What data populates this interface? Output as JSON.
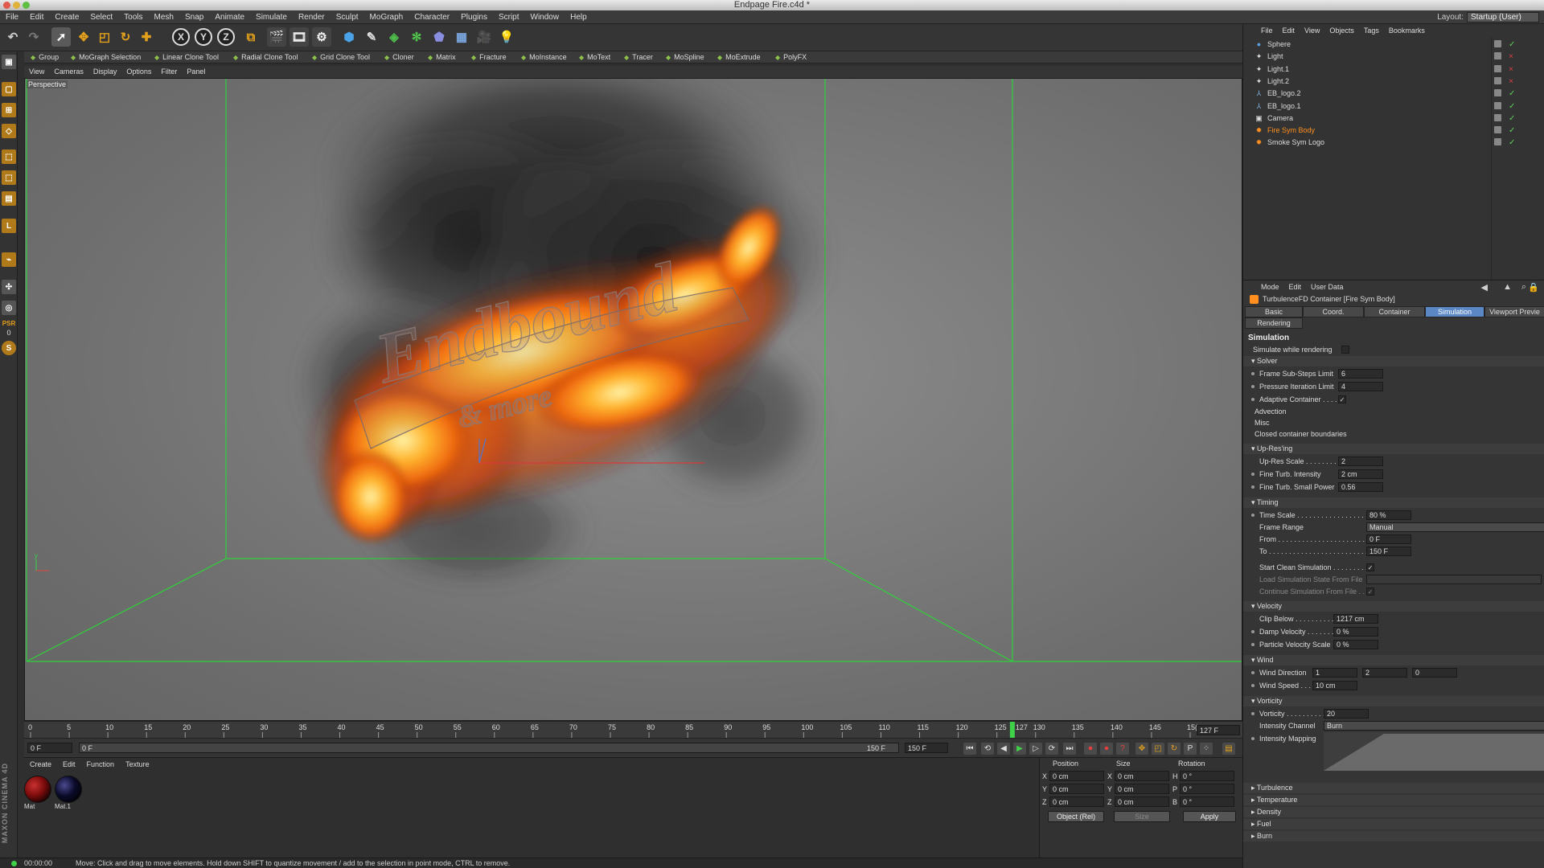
{
  "app": {
    "title": "Endpage Fire.c4d *",
    "menus": [
      "File",
      "Edit",
      "Create",
      "Select",
      "Tools",
      "Mesh",
      "Snap",
      "Animate",
      "Simulate",
      "Render",
      "Sculpt",
      "MoGraph",
      "Character",
      "Plugins",
      "Script",
      "Window",
      "Help"
    ],
    "layout_label": "Layout:",
    "layout_value": "Startup (User)"
  },
  "toolbar": {
    "axis_x": "X",
    "axis_y": "Y",
    "axis_z": "Z"
  },
  "mograph_bar": [
    "Group",
    "MoGraph Selection",
    "Linear Clone Tool",
    "Radial Clone Tool",
    "Grid Clone Tool",
    "Cloner",
    "Matrix",
    "Fracture",
    "MoInstance",
    "MoText",
    "Tracer",
    "MoSpline",
    "MoExtrude",
    "PolyFX"
  ],
  "left_palette": {
    "psr": "PSR",
    "psr_value": "0",
    "maxon": "MAXON CINEMA 4D"
  },
  "viewport": {
    "menus": [
      "View",
      "Cameras",
      "Display",
      "Options",
      "Filter",
      "Panel"
    ],
    "label": "Perspective",
    "axis_y": "y",
    "logo_text_1": "Endbound",
    "logo_text_2": "& more"
  },
  "timeline": {
    "ticks": [
      0,
      5,
      10,
      15,
      20,
      25,
      30,
      35,
      40,
      45,
      50,
      55,
      60,
      65,
      70,
      75,
      80,
      85,
      90,
      95,
      100,
      105,
      110,
      115,
      120,
      125,
      130,
      135,
      140,
      145,
      150
    ],
    "current_frame": 127,
    "max_frame": 150,
    "current_label": "127",
    "end_label": "15(",
    "current_field": "127 F"
  },
  "playbar": {
    "start_field": "0 F",
    "range_start": "0 F",
    "range_end": "150 F",
    "end_field": "150 F"
  },
  "material_manager": {
    "menus": [
      "Create",
      "Edit",
      "Function",
      "Texture"
    ],
    "materials": [
      {
        "name": "Mat",
        "color": "#7a0b0b"
      },
      {
        "name": "Mat.1",
        "color": "#0b0b2a"
      }
    ]
  },
  "coordinates": {
    "headers": [
      "Position",
      "Size",
      "Rotation"
    ],
    "rows": [
      {
        "axis": "X",
        "position": "0 cm",
        "size_axis": "X",
        "size": "0 cm",
        "rot_axis": "H",
        "rotation": "0 °"
      },
      {
        "axis": "Y",
        "position": "0 cm",
        "size_axis": "Y",
        "size": "0 cm",
        "rot_axis": "P",
        "rotation": "0 °"
      },
      {
        "axis": "Z",
        "position": "0 cm",
        "size_axis": "Z",
        "size": "0 cm",
        "rot_axis": "B",
        "rotation": "0 °"
      }
    ],
    "mode": "Object (Rel)",
    "size_mode": "Size",
    "apply": "Apply"
  },
  "status": {
    "time": "00:00:00",
    "message": "Move: Click and drag to move elements. Hold down SHIFT to quantize movement / add to the selection in point mode, CTRL to remove."
  },
  "object_manager": {
    "menus": [
      "File",
      "Edit",
      "View",
      "Objects",
      "Tags",
      "Bookmarks"
    ],
    "objects": [
      {
        "name": "Sphere",
        "icon": "sphere-icon",
        "color": "#5aa0e0",
        "x": ""
      },
      {
        "name": "Light",
        "icon": "light-icon",
        "color": "#dddddd",
        "x": "×"
      },
      {
        "name": "Light.1",
        "icon": "light-icon",
        "color": "#dddddd",
        "x": "×"
      },
      {
        "name": "Light.2",
        "icon": "light-icon",
        "color": "#dddddd",
        "x": "×"
      },
      {
        "name": "EB_logo.2",
        "icon": "null-icon",
        "color": "#7fb0e0",
        "x": ""
      },
      {
        "name": "EB_logo.1",
        "icon": "null-icon",
        "color": "#7fb0e0",
        "x": ""
      },
      {
        "name": "Camera",
        "icon": "camera-icon",
        "color": "#dddddd",
        "x": ""
      },
      {
        "name": "Fire Sym Body",
        "icon": "fluid-icon",
        "color": "#ff9020",
        "x": "",
        "selected": true
      },
      {
        "name": "Smoke Sym Logo",
        "icon": "fluid-icon",
        "color": "#ff9020",
        "x": ""
      }
    ]
  },
  "attribute_manager": {
    "menus": [
      "Mode",
      "Edit",
      "User Data"
    ],
    "header": "TurbulenceFD Container [Fire Sym Body]",
    "tabs": [
      "Basic",
      "Coord.",
      "Container",
      "Simulation",
      "Viewport Previe"
    ],
    "tab2": "Rendering",
    "section": "Simulation",
    "simulate_while_rendering": "Simulate while rendering",
    "groups": {
      "solver": "Solver",
      "upres": "Up-Res'ing",
      "timing": "Timing",
      "velocity": "Velocity",
      "wind": "Wind",
      "vorticity": "Vorticity"
    },
    "solver": {
      "frame_substeps_label": "Frame Sub-Steps Limit",
      "frame_substeps": "6",
      "pressure_label": "Pressure Iteration Limit",
      "pressure": "4",
      "adaptive_label": "Adaptive Container . . . .",
      "adaptive": "✓",
      "advection": "Advection",
      "misc": "Misc",
      "closed": "Closed container boundaries"
    },
    "upres": {
      "scale_label": "Up-Res Scale . . . . . . . . . .",
      "scale": "2",
      "fine_turb_label": "Fine Turb. Intensity",
      "fine_turb": "2 cm",
      "fine_small_label": "Fine Turb. Small Power",
      "fine_small": "0.56"
    },
    "timing": {
      "time_scale_label": "Time Scale . . . . . . . . . . . . . . . . . . .",
      "time_scale": "80 %",
      "frame_range_label": "Frame Range",
      "frame_range": "Manual",
      "from_label": "From . . . . . . . . . . . . . . . . . . . . . . . .",
      "from": "0 F",
      "to_label": "To . . . . . . . . . . . . . . . . . . . . . . . . . .",
      "to": "150 F",
      "start_clean_label": "Start Clean Simulation . . . . . . . . .",
      "start_clean": "✓",
      "load_state_label": "Load Simulation State From File",
      "continue_label": "Continue Simulation From File . . .",
      "continue": "✓"
    },
    "velocity": {
      "clip_label": "Clip Below . . . . . . . . . . .",
      "clip": "1217 cm",
      "damp_label": "Damp Velocity . . . . . . .",
      "damp": "0 %",
      "particle_label": "Particle Velocity Scale",
      "particle": "0 %"
    },
    "wind": {
      "dir_label": "Wind Direction",
      "dir_x": "1",
      "dir_y": "2",
      "dir_z": "0",
      "speed_label": "Wind Speed . . . .",
      "speed": "10 cm"
    },
    "vorticity": {
      "vort_label": "Vorticity . . . . . . . . . . .",
      "vort": "20",
      "channel_label": "Intensity Channel",
      "channel": "Burn",
      "mapping_label": "Intensity Mapping"
    },
    "collapsed": [
      "Turbulence",
      "Temperature",
      "Density",
      "Fuel",
      "Burn"
    ]
  },
  "colors": {
    "accent": "#5b87c4",
    "selected_object": "#ff9020",
    "frame_marker": "#3fd14a",
    "container_box": "#2fd23a"
  }
}
